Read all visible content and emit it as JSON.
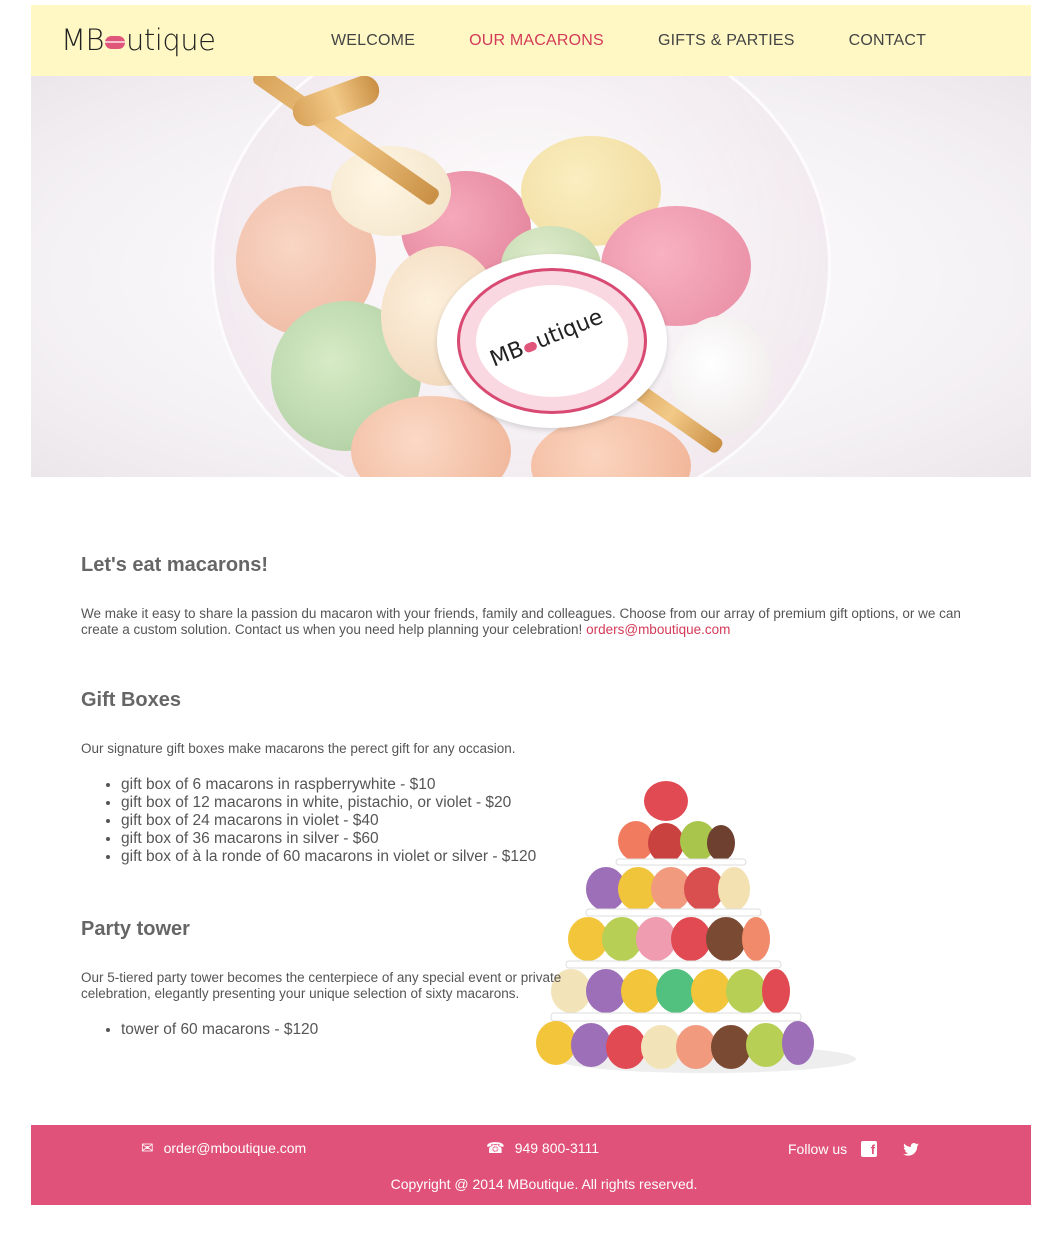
{
  "header": {
    "logo_text": {
      "a": "MB",
      "b": "utique"
    },
    "nav": [
      {
        "label": "WELCOME",
        "active": false
      },
      {
        "label": "OUR MACARONS",
        "active": true
      },
      {
        "label": "GIFTS & PARTIES",
        "active": false
      },
      {
        "label": "CONTACT",
        "active": false
      }
    ]
  },
  "hero": {
    "label_text": {
      "a": "MB",
      "b": "utique"
    }
  },
  "main": {
    "intro_title": "Let's eat macarons!",
    "intro_text": "We make it easy to share la passion du macaron with your friends, family and colleagues. Choose from our array of premium gift options, or we can create a custom solution. Contact us when you need help planning your celebration!",
    "intro_email": "orders@mboutique.com",
    "gift_title": "Gift Boxes",
    "gift_text": "Our signature gift boxes make macarons the perect gift for any occasion.",
    "gift_items": [
      "gift box of 6 macarons in raspberrywhite - $10",
      "gift box of 12 macarons in white, pistachio, or violet - $20",
      "gift box of 24 macarons in violet - $40",
      "gift box of 36 macarons in silver - $60",
      "gift box of à la ronde of 60 macarons in violet or silver - $120"
    ],
    "party_title": "Party tower",
    "party_text": "Our 5-tiered party tower becomes the centerpiece of any special event or private celebration, elegantly presenting your unique selection of sixty macarons.",
    "party_items": [
      "tower of 60 macarons - $120"
    ]
  },
  "footer": {
    "email": "order@mboutique.com",
    "phone": "949 800-3111",
    "follow": "Follow us",
    "copyright": "Copyright @ 2014 MBoutique. All rights reserved."
  },
  "colors": {
    "header_bg": "#fff8c5",
    "accent": "#d33a57",
    "footer_bg": "#e05279"
  },
  "icons": [
    "mail-icon",
    "phone-icon",
    "facebook-icon",
    "twitter-icon"
  ]
}
